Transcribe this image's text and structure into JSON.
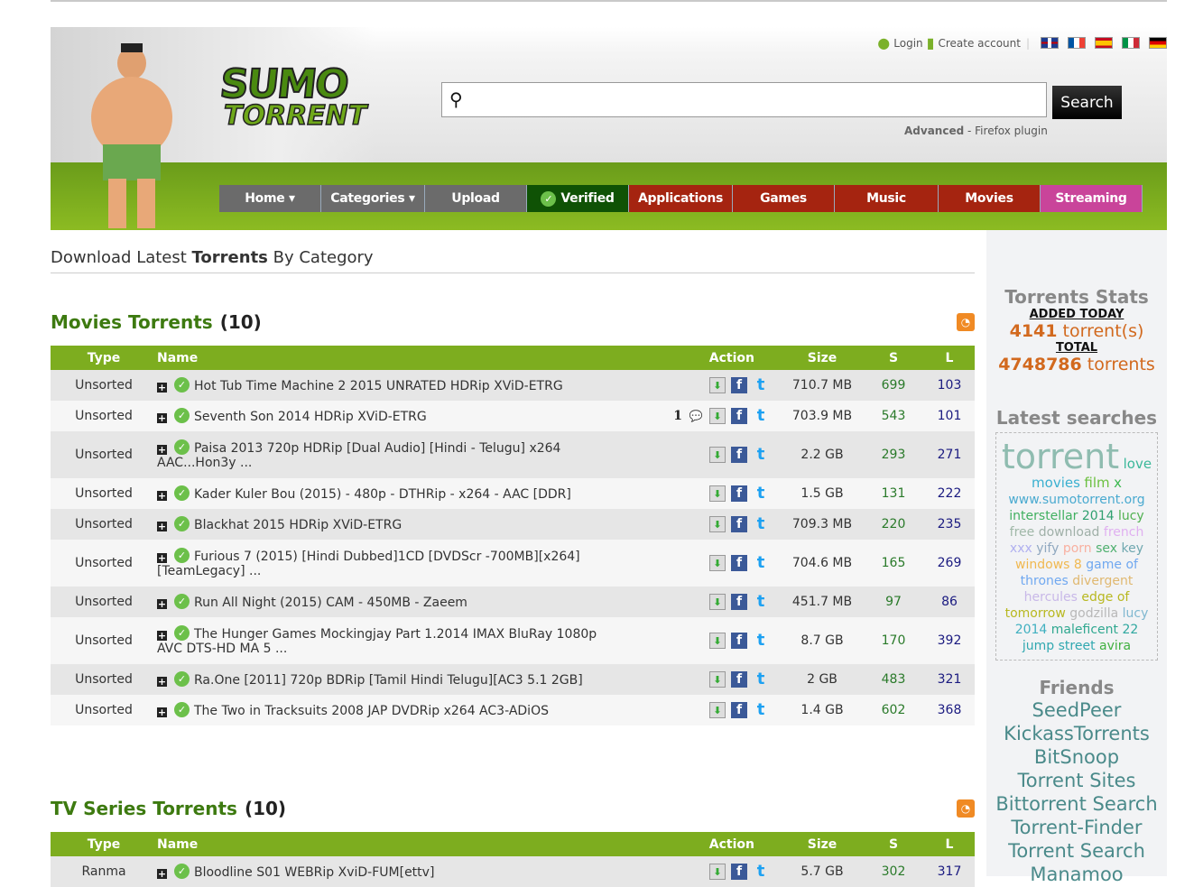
{
  "header": {
    "login": "Login",
    "create_account": "Create account",
    "search_placeholder": "",
    "search_button": "Search",
    "advanced": "Advanced",
    "separator": " - ",
    "firefox_plugin": "Firefox plugin",
    "logo_line1": "SUMO",
    "logo_line2": "TORRENT",
    "flags": [
      "en",
      "fr",
      "es",
      "it",
      "de"
    ]
  },
  "nav": [
    {
      "label": "Home ▾",
      "color": "#6b6b6b",
      "w": 113
    },
    {
      "label": "Categories ▾",
      "color": "#6b6b6b",
      "w": 115
    },
    {
      "label": "Upload",
      "color": "#6b6b6b",
      "w": 113
    },
    {
      "label": "Verified",
      "color": "#0f5205",
      "w": 113,
      "icon": "check"
    },
    {
      "label": "Applications",
      "color": "#a52410",
      "w": 115
    },
    {
      "label": "Games",
      "color": "#a52410",
      "w": 113
    },
    {
      "label": "Music",
      "color": "#a52410",
      "w": 115
    },
    {
      "label": "Movies",
      "color": "#a52410",
      "w": 113
    },
    {
      "label": "Streaming",
      "color": "#c9449a",
      "w": 113
    }
  ],
  "main": {
    "title_pre": "Download Latest ",
    "title_bold": "Torrents",
    "title_post": " By Category",
    "columns": {
      "type": "Type",
      "name": "Name",
      "action": "Action",
      "size": "Size",
      "s": "S",
      "l": "L"
    },
    "sections": [
      {
        "title": "Movies Torrents",
        "count": "(10)",
        "rows": [
          {
            "type": "Unsorted",
            "name": "Hot Tub Time Machine 2 2015 UNRATED HDRip XViD-ETRG",
            "comments": "",
            "size": "710.7 MB",
            "s": "699",
            "l": "103"
          },
          {
            "type": "Unsorted",
            "name": "Seventh Son 2014 HDRip XViD-ETRG",
            "comments": "1",
            "size": "703.9 MB",
            "s": "543",
            "l": "101"
          },
          {
            "type": "Unsorted",
            "name": "Paisa 2013 720p HDRip [Dual Audio] [Hindi - Telugu] x264 AAC...Hon3y ...",
            "comments": "",
            "size": "2.2 GB",
            "s": "293",
            "l": "271"
          },
          {
            "type": "Unsorted",
            "name": "Kader Kuler Bou (2015) - 480p - DTHRip - x264 - AAC [DDR]",
            "comments": "",
            "size": "1.5 GB",
            "s": "131",
            "l": "222"
          },
          {
            "type": "Unsorted",
            "name": "Blackhat 2015 HDRip XViD-ETRG",
            "comments": "",
            "size": "709.3 MB",
            "s": "220",
            "l": "235"
          },
          {
            "type": "Unsorted",
            "name": "Furious 7 (2015) [Hindi Dubbed]1CD [DVDScr -700MB][x264] [TeamLegacy] ...",
            "comments": "",
            "size": "704.6 MB",
            "s": "165",
            "l": "269"
          },
          {
            "type": "Unsorted",
            "name": "Run All Night (2015) CAM - 450MB - Zaeem",
            "comments": "",
            "size": "451.7 MB",
            "s": "97",
            "l": "86"
          },
          {
            "type": "Unsorted",
            "name": "The Hunger Games Mockingjay Part 1.2014 IMAX BluRay 1080p AVC DTS-HD MA 5 ...",
            "comments": "",
            "size": "8.7 GB",
            "s": "170",
            "l": "392"
          },
          {
            "type": "Unsorted",
            "name": "Ra.One [2011] 720p BDRip [Tamil Hindi Telugu][AC3 5.1 2GB]",
            "comments": "",
            "size": "2 GB",
            "s": "483",
            "l": "321"
          },
          {
            "type": "Unsorted",
            "name": "The Two in Tracksuits 2008 JAP DVDRip x264 AC3-ADiOS",
            "comments": "",
            "size": "1.4 GB",
            "s": "602",
            "l": "368"
          }
        ]
      },
      {
        "title": "TV Series Torrents",
        "count": "(10)",
        "rows": [
          {
            "type": "Ranma",
            "name": "Bloodline S01 WEBRip XviD-FUM[ettv]",
            "comments": "",
            "size": "5.7 GB",
            "s": "302",
            "l": "317"
          }
        ]
      }
    ]
  },
  "sidebar": {
    "stats_title": "Torrents Stats",
    "added_today_label": "ADDED TODAY",
    "added_today_num": "4141",
    "added_today_unit": " torrent(s)",
    "total_label": "TOTAL",
    "total_num": "4748786",
    "total_unit": " torrents",
    "latest_title": "Latest searches",
    "cloud": [
      {
        "t": "torrent",
        "c": "#8fbcb0",
        "s": 38
      },
      {
        "t": "love",
        "c": "#3cb89a",
        "s": 15
      },
      {
        "t": "movies",
        "c": "#3ab0d0",
        "s": 15
      },
      {
        "t": "film",
        "c": "#6cc040",
        "s": 15
      },
      {
        "t": "x",
        "c": "#3cb850",
        "s": 15
      },
      {
        "t": "www.sumotorrent.org",
        "c": "#4aaad0",
        "s": 14
      },
      {
        "t": "interstellar",
        "c": "#40b060",
        "s": 14
      },
      {
        "t": "2014",
        "c": "#30a070",
        "s": 14
      },
      {
        "t": "lucy",
        "c": "#50b050",
        "s": 14
      },
      {
        "t": "free",
        "c": "#a0b8a8",
        "s": 14
      },
      {
        "t": "download",
        "c": "#a0b0a8",
        "s": 14
      },
      {
        "t": "french",
        "c": "#e0b0f0",
        "s": 14
      },
      {
        "t": "xxx",
        "c": "#b0b0f0",
        "s": 14
      },
      {
        "t": "yify",
        "c": "#90a8c0",
        "s": 14
      },
      {
        "t": "porn",
        "c": "#f8b0a0",
        "s": 14
      },
      {
        "t": "sex",
        "c": "#50b070",
        "s": 14
      },
      {
        "t": "key",
        "c": "#70a8b0",
        "s": 14
      },
      {
        "t": "windows",
        "c": "#f0b850",
        "s": 14
      },
      {
        "t": "8",
        "c": "#f0b850",
        "s": 14
      },
      {
        "t": "game",
        "c": "#70a8f0",
        "s": 14
      },
      {
        "t": "of",
        "c": "#70a8f0",
        "s": 14
      },
      {
        "t": "thrones",
        "c": "#70a8f0",
        "s": 14
      },
      {
        "t": "divergent",
        "c": "#e0b870",
        "s": 14
      },
      {
        "t": "hercules",
        "c": "#c8b8e8",
        "s": 14
      },
      {
        "t": "edge",
        "c": "#b8b820",
        "s": 14
      },
      {
        "t": "of",
        "c": "#b8b820",
        "s": 14
      },
      {
        "t": "tomorrow",
        "c": "#b8b820",
        "s": 14
      },
      {
        "t": "godzilla",
        "c": "#b8b8b8",
        "s": 14
      },
      {
        "t": "lucy",
        "c": "#80b8d0",
        "s": 14
      },
      {
        "t": "2014",
        "c": "#40b0c0",
        "s": 14
      },
      {
        "t": "maleficent",
        "c": "#30a890",
        "s": 14
      },
      {
        "t": "22",
        "c": "#30a8a0",
        "s": 14
      },
      {
        "t": "jump",
        "c": "#30a8b0",
        "s": 14
      },
      {
        "t": "street",
        "c": "#30a8b0",
        "s": 14
      },
      {
        "t": "avira",
        "c": "#40b040",
        "s": 14
      }
    ],
    "friends_title": "Friends",
    "friends": [
      "SeedPeer",
      "KickassTorrents",
      "BitSnoop",
      "Torrent Sites",
      "Bittorrent Search",
      "Torrent-Finder",
      "Torrent Search",
      "Manamoo"
    ]
  }
}
